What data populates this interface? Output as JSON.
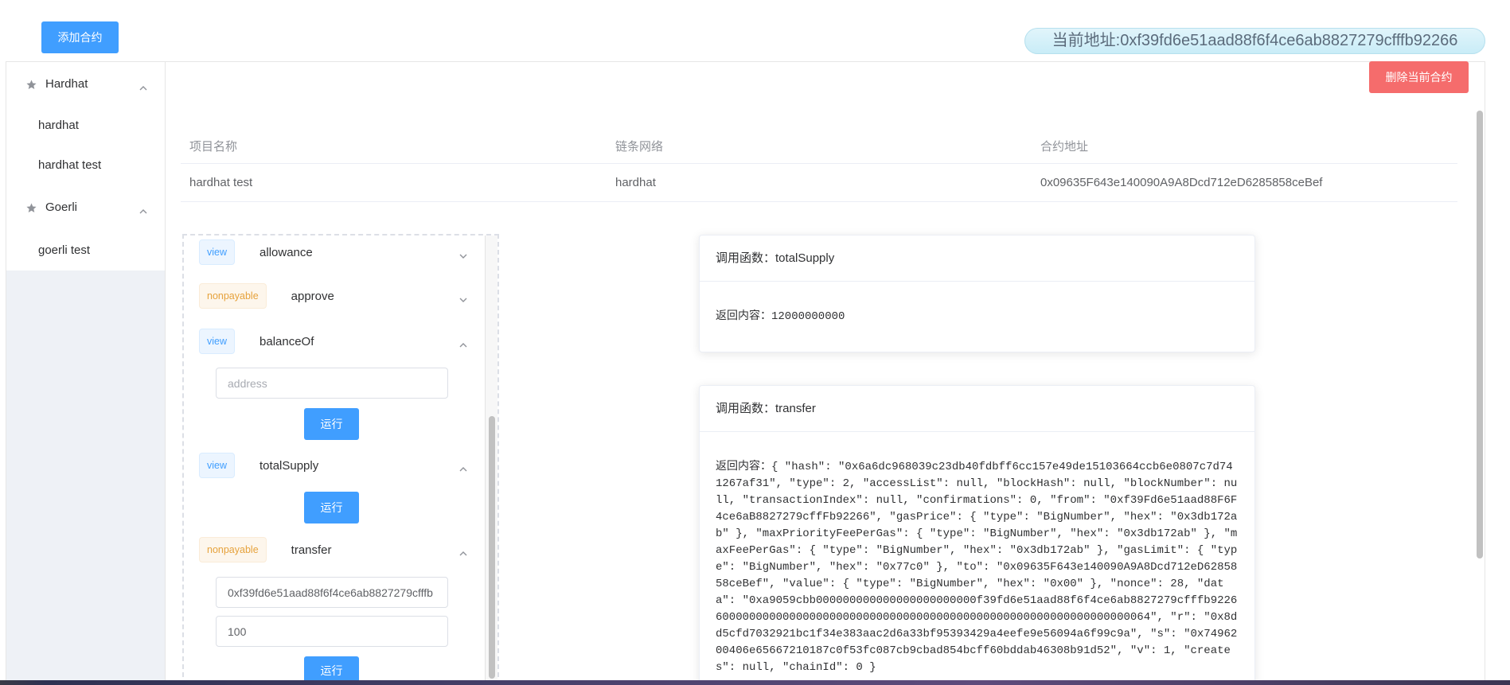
{
  "toolbar": {
    "add_contract_label": "添加合约"
  },
  "current_address": {
    "label": "当前地址:",
    "value": "0xf39fd6e51aad88f6f4ce6ab8827279cfffb92266"
  },
  "sidebar": {
    "groups": [
      {
        "name": "Hardhat",
        "icon": "star-icon",
        "chevron": "chevron-up-icon",
        "items": [
          {
            "label": "hardhat"
          },
          {
            "label": "hardhat test"
          }
        ]
      },
      {
        "name": "Goerli",
        "icon": "star-icon",
        "chevron": "chevron-up-icon",
        "items": [
          {
            "label": "goerli test"
          }
        ]
      }
    ]
  },
  "main": {
    "delete_contract_label": "删除当前合约",
    "contract_table": {
      "columns": [
        "项目名称",
        "链条网络",
        "合约地址"
      ],
      "rows": [
        [
          "hardhat test",
          "hardhat",
          "0x09635F643e140090A9A8Dcd712eD6285858ceBef"
        ]
      ]
    },
    "functions": [
      {
        "type": "view",
        "name": "allowance",
        "chevron": "chevron-down-icon"
      },
      {
        "type": "nonpayable",
        "name": "approve",
        "chevron": "chevron-down-icon"
      },
      {
        "type": "view",
        "name": "balanceOf",
        "chevron": "chevron-up-icon",
        "inputs": [
          {
            "placeholder": "address"
          }
        ],
        "run_label": "运行"
      },
      {
        "type": "view",
        "name": "totalSupply",
        "chevron": "chevron-up-icon",
        "run_label": "运行"
      },
      {
        "type": "nonpayable",
        "name": "transfer",
        "chevron": "chevron-up-icon",
        "inputs": [
          {
            "value": "0xf39fd6e51aad88f6f4ce6ab8827279cfffb"
          },
          {
            "value": "100"
          }
        ],
        "run_label": "运行"
      }
    ],
    "results": [
      {
        "function_label": "调用函数：",
        "function_name": "totalSupply",
        "result_label": "返回内容：",
        "result_value": "12000000000"
      },
      {
        "function_label": "调用函数：",
        "function_name": "transfer",
        "result_label": "返回内容：",
        "result_value": "{ \"hash\": \"0x6a6dc968039c23db40fdbff6cc157e49de15103664ccb6e0807c7d741267af31\", \"type\": 2, \"accessList\": null, \"blockHash\": null, \"blockNumber\": null, \"transactionIndex\": null, \"confirmations\": 0, \"from\": \"0xf39Fd6e51aad88F6F4ce6aB8827279cffFb92266\", \"gasPrice\": { \"type\": \"BigNumber\", \"hex\": \"0x3db172ab\" }, \"maxPriorityFeePerGas\": { \"type\": \"BigNumber\", \"hex\": \"0x3db172ab\" }, \"maxFeePerGas\": { \"type\": \"BigNumber\", \"hex\": \"0x3db172ab\" }, \"gasLimit\": { \"type\": \"BigNumber\", \"hex\": \"0x77c0\" }, \"to\": \"0x09635F643e140090A9A8Dcd712eD6285858ceBef\", \"value\": { \"type\": \"BigNumber\", \"hex\": \"0x00\" }, \"nonce\": 28, \"data\": \"0xa9059cbb000000000000000000000000f39fd6e51aad88f6f4ce6ab8827279cfffb922660000000000000000000000000000000000000000000000000000000000000064\", \"r\": \"0x8dd5cfd7032921bc1f34e383aac2d6a33bf95393429a4eefe9e56094a6f99c9a\", \"s\": \"0x7496200406e65667210187c0f53fc087cb9cbad854bcff60bddab46308b91d52\", \"v\": 1, \"creates\": null, \"chainId\": 0 }"
      }
    ]
  },
  "colors": {
    "primary": "#409eff",
    "danger": "#f56c6c",
    "view_tag": "#409eff",
    "nonpayable_tag": "#e6a23c",
    "sidebar_background": "#eef1f6"
  }
}
